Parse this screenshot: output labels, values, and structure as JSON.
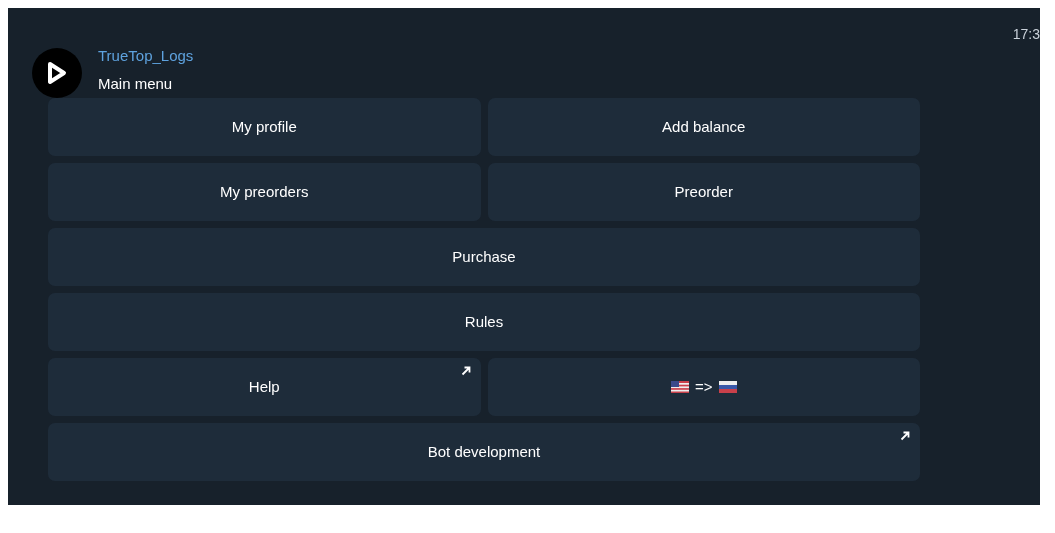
{
  "message": {
    "sender": "TrueTop_Logs",
    "text": "Main menu",
    "time": "17:3"
  },
  "keyboard": [
    [
      {
        "label": "My profile",
        "link": false
      },
      {
        "label": "Add balance",
        "link": false
      }
    ],
    [
      {
        "label": "My preorders",
        "link": false
      },
      {
        "label": "Preorder",
        "link": false
      }
    ],
    [
      {
        "label": "Purchase",
        "link": false
      }
    ],
    [
      {
        "label": "Rules",
        "link": false
      }
    ],
    [
      {
        "label": "Help",
        "link": true
      },
      {
        "label": "=>",
        "link": false,
        "kind": "flag-swap"
      }
    ],
    [
      {
        "label": "Bot development",
        "link": true
      }
    ]
  ]
}
